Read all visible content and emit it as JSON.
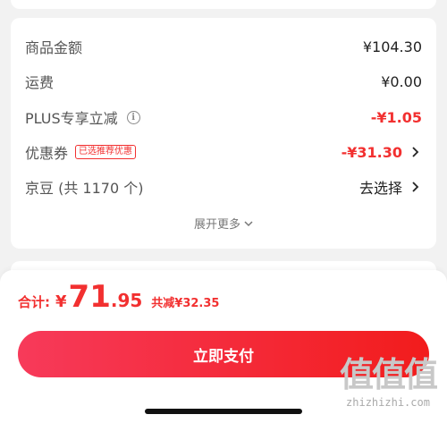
{
  "summary": {
    "rows": [
      {
        "label": "商品金额",
        "value": "¥104.30"
      },
      {
        "label": "运费",
        "value": "¥0.00"
      },
      {
        "label": "PLUS专享立减",
        "value": "-¥1.05"
      },
      {
        "label": "优惠券",
        "badge": "已选推荐优惠",
        "value": "-¥31.30"
      },
      {
        "label": "京豆 (共 1170 个)",
        "value": "去选择"
      }
    ],
    "expand_label": "展开更多"
  },
  "footer": {
    "total_label": "合计:",
    "currency": "¥",
    "amount_int": "71",
    "amount_dec": ".95",
    "saved_text": "共减¥32.35",
    "pay_button": "立即支付"
  },
  "watermark": {
    "logo_text": "值值值",
    "url": "zhizhizhi.com"
  },
  "colors": {
    "accent": "#f23030",
    "button_start": "#f73a5a",
    "button_end": "#f21c1c"
  }
}
